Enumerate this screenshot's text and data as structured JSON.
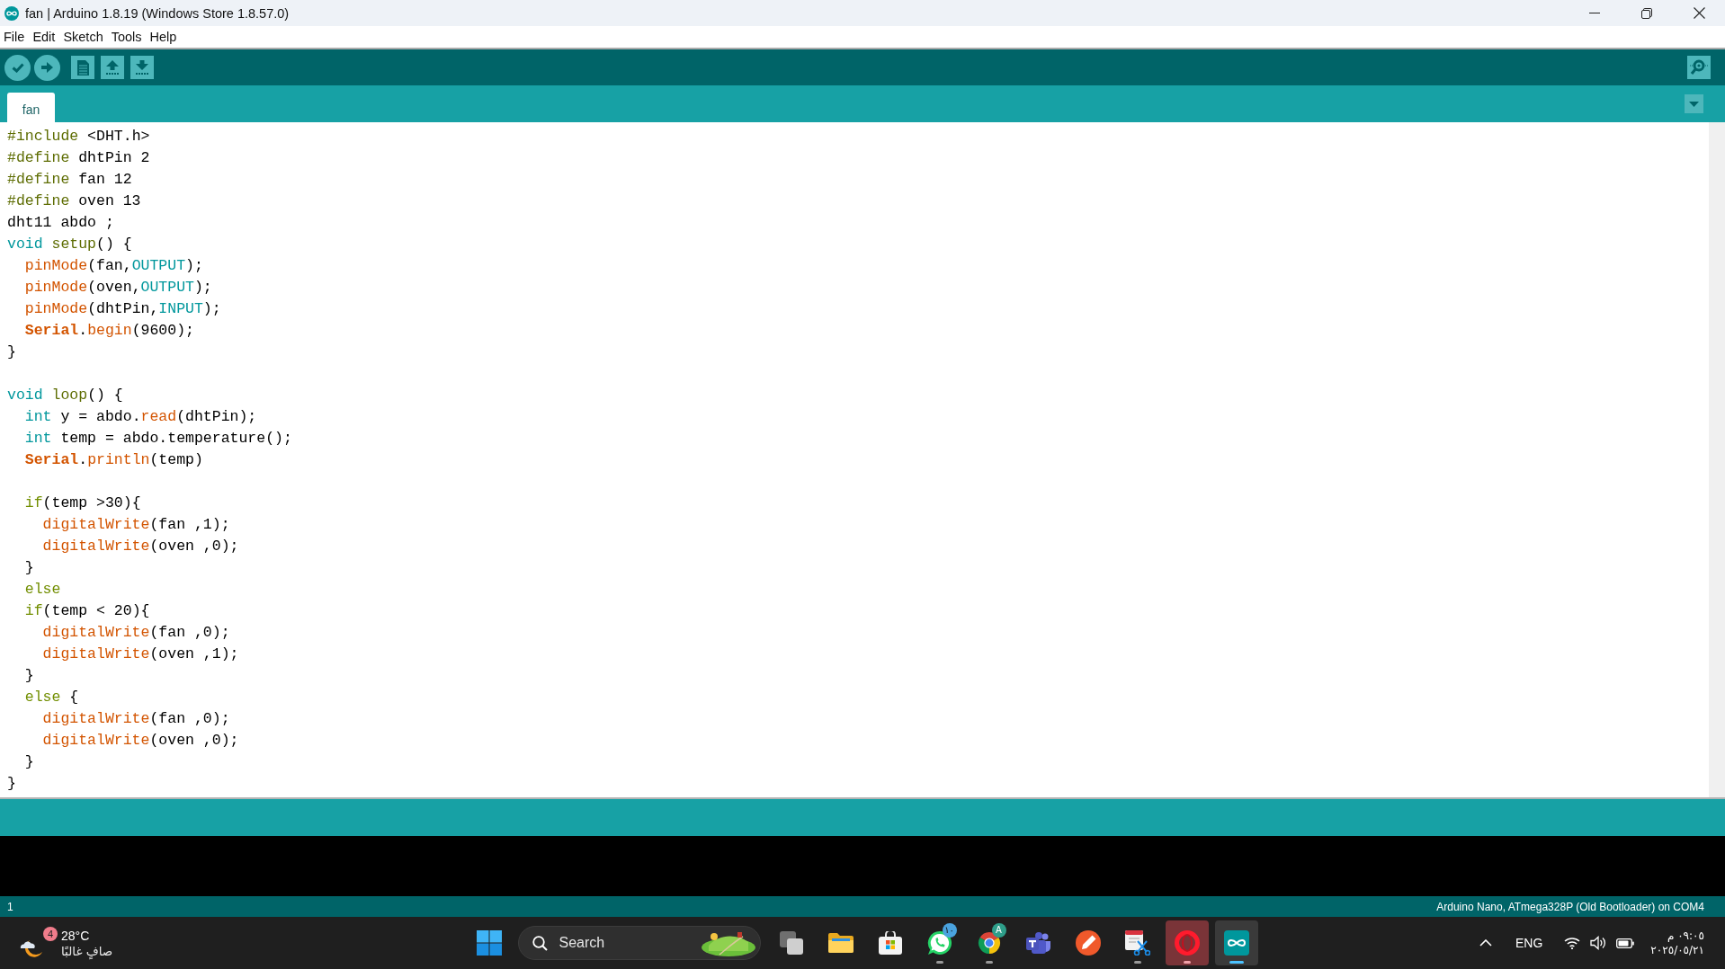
{
  "window": {
    "title": "fan | Arduino 1.8.19 (Windows Store 1.8.57.0)"
  },
  "menu": [
    "File",
    "Edit",
    "Sketch",
    "Tools",
    "Help"
  ],
  "tabs": [
    {
      "label": "fan",
      "selected": true
    }
  ],
  "editor": {
    "lines": [
      {
        "kind": "code",
        "tokens": [
          {
            "text": "#include",
            "kind": "directive"
          },
          {
            "text": " <DHT.h>",
            "kind": "plain"
          }
        ]
      },
      {
        "kind": "code",
        "tokens": [
          {
            "text": "#define",
            "kind": "directive"
          },
          {
            "text": " dhtPin 2",
            "kind": "plain"
          }
        ]
      },
      {
        "kind": "code",
        "tokens": [
          {
            "text": "#define",
            "kind": "directive"
          },
          {
            "text": " fan 12",
            "kind": "plain"
          }
        ]
      },
      {
        "kind": "code",
        "tokens": [
          {
            "text": "#define",
            "kind": "directive"
          },
          {
            "text": " oven 13",
            "kind": "plain"
          }
        ]
      },
      {
        "kind": "code",
        "tokens": [
          {
            "text": "dht11 abdo ;",
            "kind": "plain"
          }
        ]
      },
      {
        "kind": "code",
        "tokens": [
          {
            "text": "void",
            "kind": "type"
          },
          {
            "text": " setup",
            "kind": "structure"
          },
          {
            "text": "() {",
            "kind": "plain"
          }
        ]
      },
      {
        "kind": "code",
        "tokens": [
          {
            "text": "  pinMode",
            "kind": "function"
          },
          {
            "text": "(fan,",
            "kind": "plain"
          },
          {
            "text": "OUTPUT",
            "kind": "constant"
          },
          {
            "text": ");",
            "kind": "plain"
          }
        ]
      },
      {
        "kind": "code",
        "tokens": [
          {
            "text": "  pinMode",
            "kind": "function"
          },
          {
            "text": "(oven,",
            "kind": "plain"
          },
          {
            "text": "OUTPUT",
            "kind": "constant"
          },
          {
            "text": ");",
            "kind": "plain"
          }
        ]
      },
      {
        "kind": "code",
        "tokens": [
          {
            "text": "  pinMode",
            "kind": "function"
          },
          {
            "text": "(dhtPin,",
            "kind": "plain"
          },
          {
            "text": "INPUT",
            "kind": "constant"
          },
          {
            "text": ");",
            "kind": "plain"
          }
        ]
      },
      {
        "kind": "code",
        "tokens": [
          {
            "text": "  Serial",
            "kind": "class"
          },
          {
            "text": ".",
            "kind": "plain"
          },
          {
            "text": "begin",
            "kind": "function"
          },
          {
            "text": "(9600);",
            "kind": "plain"
          }
        ]
      },
      {
        "kind": "code",
        "tokens": [
          {
            "text": "}",
            "kind": "plain"
          }
        ]
      },
      {
        "kind": "blank"
      },
      {
        "kind": "code",
        "tokens": [
          {
            "text": "void",
            "kind": "type"
          },
          {
            "text": " loop",
            "kind": "structure"
          },
          {
            "text": "() {",
            "kind": "plain"
          }
        ]
      },
      {
        "kind": "code",
        "tokens": [
          {
            "text": "  int",
            "kind": "type"
          },
          {
            "text": " y = abdo.",
            "kind": "plain"
          },
          {
            "text": "read",
            "kind": "function"
          },
          {
            "text": "(dhtPin);",
            "kind": "plain"
          }
        ]
      },
      {
        "kind": "code",
        "tokens": [
          {
            "text": "  int",
            "kind": "type"
          },
          {
            "text": " temp = abdo.temperature();",
            "kind": "plain"
          }
        ]
      },
      {
        "kind": "code",
        "tokens": [
          {
            "text": "  Serial",
            "kind": "class"
          },
          {
            "text": ".",
            "kind": "plain"
          },
          {
            "text": "println",
            "kind": "function"
          },
          {
            "text": "(temp)",
            "kind": "plain"
          }
        ]
      },
      {
        "kind": "blank"
      },
      {
        "kind": "code",
        "tokens": [
          {
            "text": "  if",
            "kind": "control"
          },
          {
            "text": "(temp >30){",
            "kind": "plain"
          }
        ]
      },
      {
        "kind": "code",
        "tokens": [
          {
            "text": "    digitalWrite",
            "kind": "function"
          },
          {
            "text": "(fan ,1);",
            "kind": "plain"
          }
        ]
      },
      {
        "kind": "code",
        "tokens": [
          {
            "text": "    digitalWrite",
            "kind": "function"
          },
          {
            "text": "(oven ,0);",
            "kind": "plain"
          }
        ]
      },
      {
        "kind": "code",
        "tokens": [
          {
            "text": "  }",
            "kind": "plain"
          }
        ]
      },
      {
        "kind": "code",
        "tokens": [
          {
            "text": "  else",
            "kind": "control"
          }
        ]
      },
      {
        "kind": "code",
        "tokens": [
          {
            "text": "  if",
            "kind": "control"
          },
          {
            "text": "(temp < 20){",
            "kind": "plain"
          }
        ]
      },
      {
        "kind": "code",
        "tokens": [
          {
            "text": "    digitalWrite",
            "kind": "function"
          },
          {
            "text": "(fan ,0);",
            "kind": "plain"
          }
        ]
      },
      {
        "kind": "code",
        "tokens": [
          {
            "text": "    digitalWrite",
            "kind": "function"
          },
          {
            "text": "(oven ,1);",
            "kind": "plain"
          }
        ]
      },
      {
        "kind": "code",
        "tokens": [
          {
            "text": "  }",
            "kind": "plain"
          }
        ]
      },
      {
        "kind": "code",
        "tokens": [
          {
            "text": "  else",
            "kind": "control"
          },
          {
            "text": " {",
            "kind": "plain"
          }
        ]
      },
      {
        "kind": "code",
        "tokens": [
          {
            "text": "    digitalWrite",
            "kind": "function"
          },
          {
            "text": "(fan ,0);",
            "kind": "plain"
          }
        ]
      },
      {
        "kind": "code",
        "tokens": [
          {
            "text": "    digitalWrite",
            "kind": "function"
          },
          {
            "text": "(oven ,0);",
            "kind": "plain"
          }
        ]
      },
      {
        "kind": "code",
        "tokens": [
          {
            "text": "  }",
            "kind": "plain"
          }
        ]
      },
      {
        "kind": "code",
        "tokens": [
          {
            "text": "}",
            "kind": "plain"
          }
        ]
      }
    ]
  },
  "status_bar": {
    "line": "1",
    "board": "Arduino Nano, ATmega328P (Old Bootloader) on COM4"
  },
  "taskbar": {
    "weather": {
      "badge": "4",
      "temperature": "28°C",
      "condition": "صافٍ غالبًا"
    },
    "search": {
      "placeholder": "Search"
    },
    "apps": [
      {
        "running": false,
        "selected": false,
        "flashing": false
      },
      {
        "running": false,
        "selected": false,
        "flashing": false
      },
      {
        "running": false,
        "selected": false,
        "flashing": false
      },
      {
        "running": true,
        "selected": false,
        "flashing": false,
        "badge": "١٠"
      },
      {
        "running": true,
        "selected": false,
        "flashing": false,
        "badge": "A"
      },
      {
        "running": false,
        "selected": false,
        "flashing": false
      },
      {
        "running": false,
        "selected": false,
        "flashing": false
      },
      {
        "running": true,
        "selected": false,
        "flashing": false
      },
      {
        "running": true,
        "selected": false,
        "flashing": true
      },
      {
        "running": true,
        "selected": true,
        "flashing": false
      }
    ],
    "tray": {
      "language": "ENG",
      "time": "٠٩:٠٥ م",
      "date": "٢٠٢٥/٠٥/٢١"
    }
  }
}
